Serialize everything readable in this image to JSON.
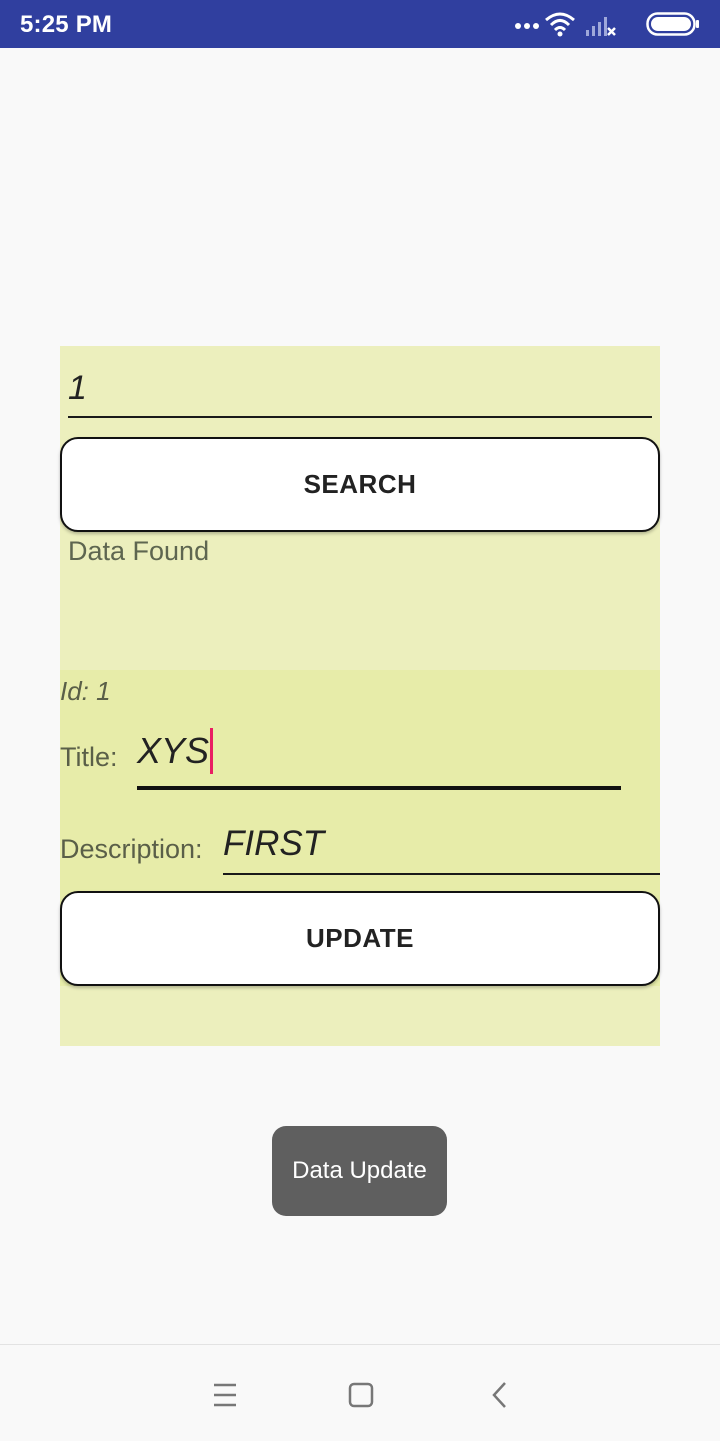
{
  "status_bar": {
    "time": "5:25 PM",
    "icons": [
      "more-dots-icon",
      "wifi-icon",
      "signal-no-service-icon",
      "battery-icon"
    ]
  },
  "search": {
    "query_value": "1",
    "button_label": "SEARCH",
    "result_text": "Data Found"
  },
  "record": {
    "id_text": "Id: 1",
    "title_label": "Title:",
    "title_value": "XYS",
    "description_label": "Description:",
    "description_value": "FIRST",
    "update_button_label": "UPDATE"
  },
  "toast": {
    "message": "Data Update"
  },
  "nav_bar": {
    "icons": [
      "menu-icon",
      "home-icon",
      "back-icon"
    ]
  },
  "colors": {
    "status_bar": "#303f9f",
    "panel": "#ecefbd",
    "panel_lower": "#e7eca9",
    "caret": "#e91e63",
    "toast": "#5f5f5f"
  }
}
